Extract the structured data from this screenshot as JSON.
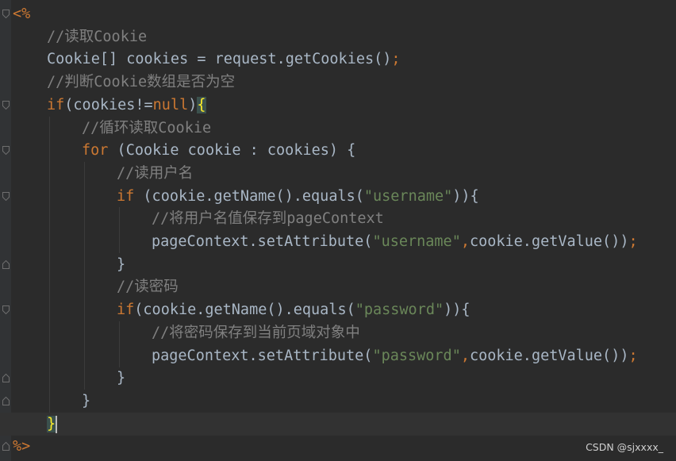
{
  "editor": {
    "open_tag": "<%",
    "close_tag": "%>",
    "watermark": "CSDN @sjxxxx_"
  },
  "lines": [
    {
      "t": [
        {
          "c": "tag",
          "v": "<%"
        }
      ]
    },
    {
      "t": [
        {
          "c": "c",
          "v": "//读取Cookie"
        }
      ]
    },
    {
      "t": [
        {
          "c": "p",
          "v": "Cookie[] cookies = request.getCookies()"
        },
        {
          "c": "k",
          "v": ";"
        }
      ]
    },
    {
      "t": [
        {
          "c": "c",
          "v": "//判断Cookie数组是否为空"
        }
      ]
    },
    {
      "t": [
        {
          "c": "k",
          "v": "if"
        },
        {
          "c": "p",
          "v": "(cookies!="
        },
        {
          "c": "k",
          "v": "null"
        },
        {
          "c": "p",
          "v": ")"
        },
        {
          "c": "br-hl",
          "v": "{"
        }
      ]
    },
    {
      "t": [
        {
          "c": "c",
          "v": "//循环读取Cookie"
        }
      ]
    },
    {
      "t": [
        {
          "c": "k",
          "v": "for"
        },
        {
          "c": "p",
          "v": " (Cookie cookie : cookies) {"
        }
      ]
    },
    {
      "t": [
        {
          "c": "c",
          "v": "//读用户名"
        }
      ]
    },
    {
      "t": [
        {
          "c": "k",
          "v": "if"
        },
        {
          "c": "p",
          "v": " (cookie.getName().equals("
        },
        {
          "c": "s",
          "v": "\"username\""
        },
        {
          "c": "p",
          "v": ")){"
        }
      ]
    },
    {
      "t": [
        {
          "c": "c",
          "v": "//将用户名值保存到pageContext"
        }
      ]
    },
    {
      "t": [
        {
          "c": "p",
          "v": "pageContext.setAttribute("
        },
        {
          "c": "s",
          "v": "\"username\""
        },
        {
          "c": "k",
          "v": ","
        },
        {
          "c": "p",
          "v": "cookie.getValue())"
        },
        {
          "c": "k",
          "v": ";"
        }
      ]
    },
    {
      "t": [
        {
          "c": "p",
          "v": "}"
        }
      ]
    },
    {
      "t": [
        {
          "c": "c",
          "v": "//读密码"
        }
      ]
    },
    {
      "t": [
        {
          "c": "k",
          "v": "if"
        },
        {
          "c": "p",
          "v": "(cookie.getName().equals("
        },
        {
          "c": "s",
          "v": "\"password\""
        },
        {
          "c": "p",
          "v": ")){"
        }
      ]
    },
    {
      "t": [
        {
          "c": "c",
          "v": "//将密码保存到当前页域对象中"
        }
      ]
    },
    {
      "t": [
        {
          "c": "p",
          "v": "pageContext.setAttribute("
        },
        {
          "c": "s",
          "v": "\"password\""
        },
        {
          "c": "k",
          "v": ","
        },
        {
          "c": "p",
          "v": "cookie.getValue())"
        },
        {
          "c": "k",
          "v": ";"
        }
      ]
    },
    {
      "t": [
        {
          "c": "p",
          "v": "}"
        }
      ]
    },
    {
      "t": [
        {
          "c": "p",
          "v": "}"
        }
      ]
    },
    {
      "t": [
        {
          "c": "br-hl",
          "v": "}"
        }
      ],
      "current": true
    },
    {
      "t": [
        {
          "c": "tag",
          "v": "%>"
        }
      ]
    }
  ]
}
